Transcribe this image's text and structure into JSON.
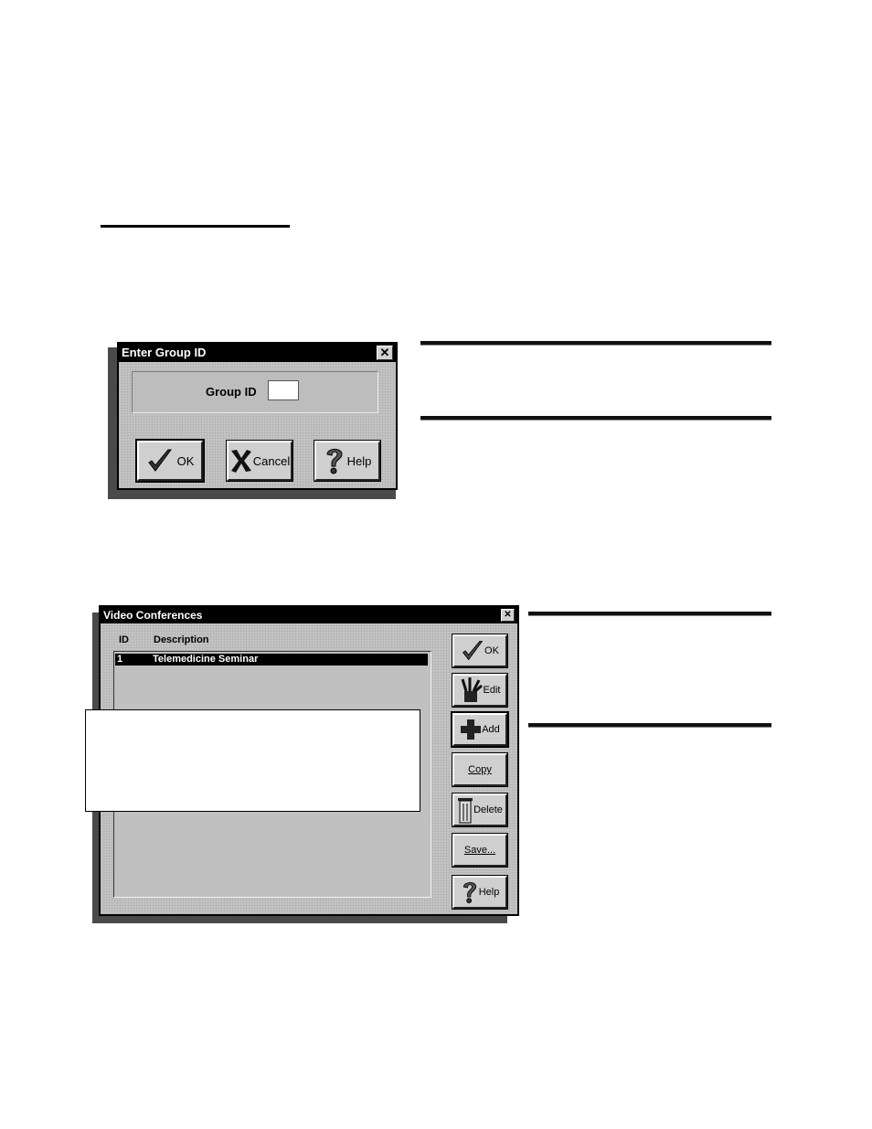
{
  "group_dialog": {
    "title": "Enter Group ID",
    "close_glyph": "✕",
    "field_label": "Group ID",
    "field_value": "",
    "buttons": {
      "ok": "OK",
      "cancel": "Cancel",
      "help": "Help"
    }
  },
  "video_dialog": {
    "title": "Video Conferences",
    "close_glyph": "✕",
    "columns": {
      "id": "ID",
      "description": "Description"
    },
    "rows": [
      {
        "id": "1",
        "description": "Telemedicine Seminar"
      }
    ],
    "buttons": {
      "ok": "OK",
      "edit": "Edit",
      "add": "Add",
      "copy": "Copy",
      "delete": "Delete",
      "save": "Save...",
      "help": "Help"
    }
  },
  "icons": [
    "checkmark-icon",
    "x-mark-icon",
    "question-mark-icon",
    "pencil-cup-icon",
    "plus-icon",
    "trash-can-icon",
    "close-icon"
  ]
}
